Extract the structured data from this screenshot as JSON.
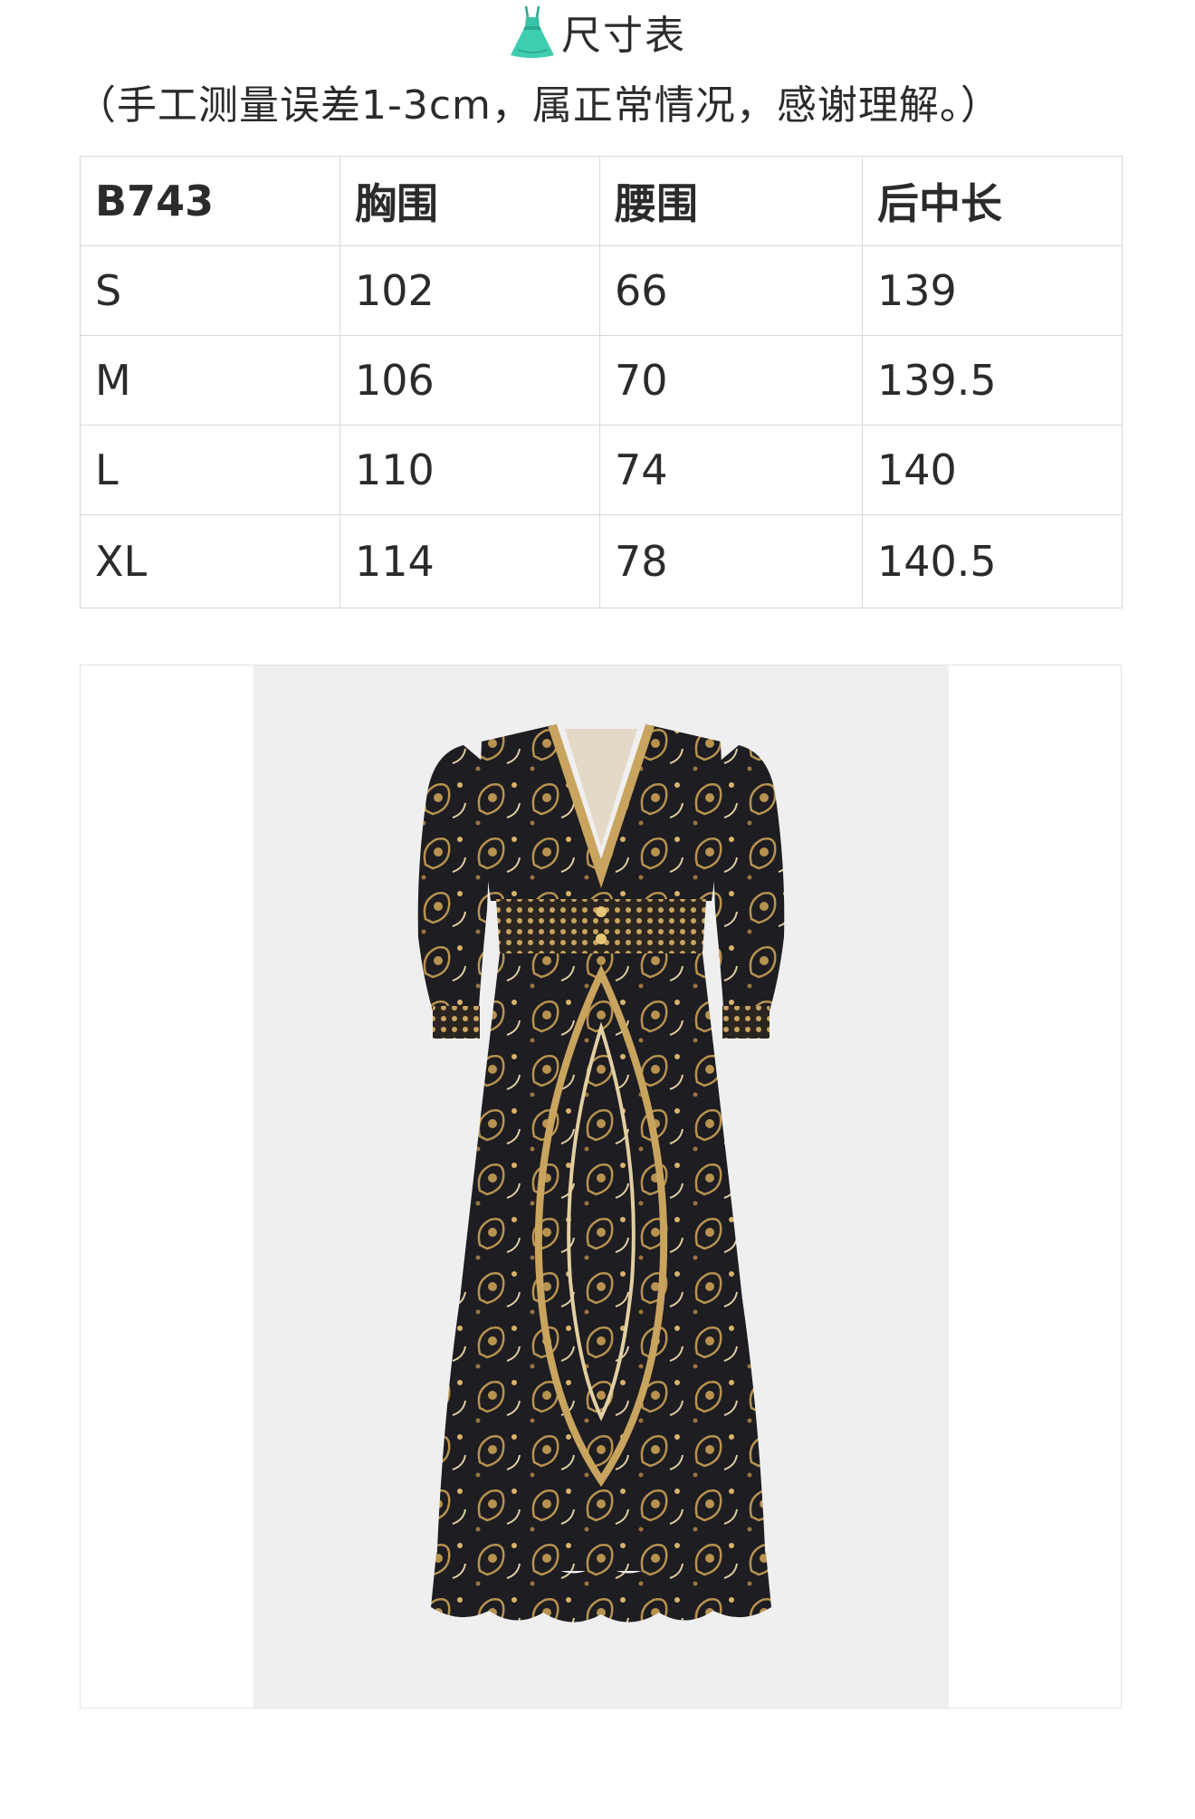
{
  "header": {
    "icon": "dress-icon",
    "title": "尺寸表",
    "note": "（手工测量误差1-3cm，属正常情况，感谢理解。）"
  },
  "size_table": {
    "columns": [
      "B743",
      "胸围",
      "腰围",
      "后中长"
    ],
    "rows": [
      [
        "S",
        "102",
        "66",
        "139"
      ],
      [
        "M",
        "106",
        "70",
        "139.5"
      ],
      [
        "L",
        "110",
        "74",
        "140"
      ],
      [
        "XL",
        "114",
        "78",
        "140.5"
      ]
    ]
  },
  "product_photo": {
    "subject": "dress-photo",
    "colors": {
      "background": "#efefef",
      "dress_base": "#1d1d22",
      "pattern_gold": "#b8924f",
      "pattern_light": "#e2cfa2"
    }
  }
}
